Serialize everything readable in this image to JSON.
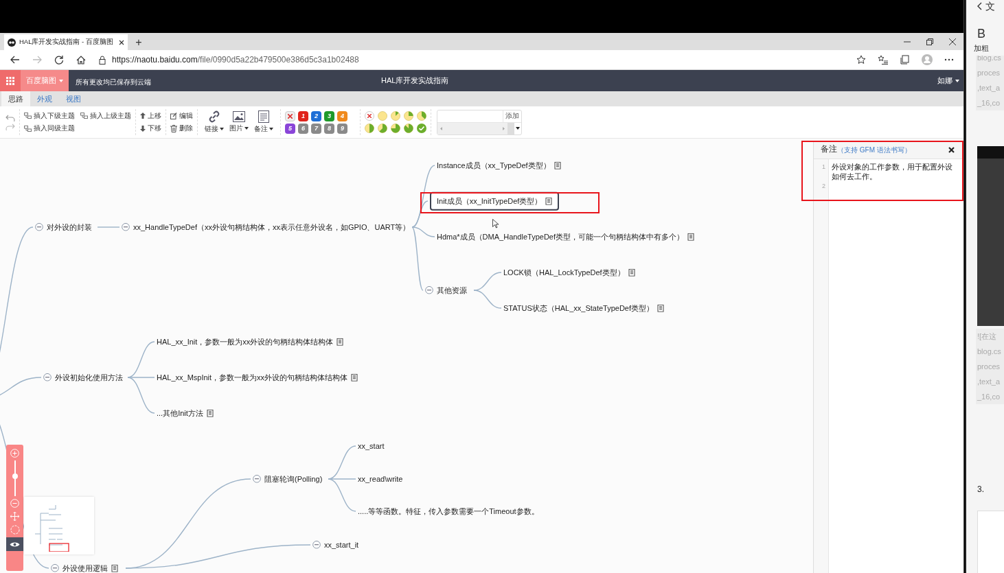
{
  "browser": {
    "tab_title": "HAL库开发实战指南 - 百度脑图",
    "new_tab": "+",
    "url_host": "https://naotu.baidu.com",
    "url_path": "/file/0990d5a22b479500e386d5c3a1b02488"
  },
  "app": {
    "brand": "百度脑图",
    "save_status": "所有更改均已保存到云端",
    "doc_title": "HAL库开发实战指南",
    "user": "如娜"
  },
  "tabs": [
    {
      "label": "思路",
      "selected": true
    },
    {
      "label": "外观",
      "selected": false
    },
    {
      "label": "视图",
      "selected": false
    }
  ],
  "toolbar": {
    "insert_child": "插入下级主题",
    "insert_parent": "插入上级主题",
    "insert_sibling": "插入同级主题",
    "move_up": "上移",
    "move_down": "下移",
    "edit": "编辑",
    "delete": "删除",
    "link": "链接",
    "image": "图片",
    "note": "备注",
    "priorities": [
      {
        "kind": "clear"
      },
      {
        "kind": "number",
        "label": "1",
        "color": "#e0241c"
      },
      {
        "kind": "number",
        "label": "2",
        "color": "#1f6fd6"
      },
      {
        "kind": "number",
        "label": "3",
        "color": "#1f9a2a"
      },
      {
        "kind": "number",
        "label": "4",
        "color": "#f08a1c"
      },
      {
        "kind": "number",
        "label": "5",
        "color": "#8a45d8"
      },
      {
        "kind": "number",
        "label": "6",
        "color": "#8a8a8a"
      },
      {
        "kind": "number",
        "label": "7",
        "color": "#8a8a8a"
      },
      {
        "kind": "number",
        "label": "8",
        "color": "#8a8a8a"
      },
      {
        "kind": "number",
        "label": "9",
        "color": "#8a8a8a"
      }
    ],
    "progress": [
      {
        "kind": "clear"
      },
      {
        "kind": "empty"
      },
      {
        "kind": "eighth"
      },
      {
        "kind": "quarter"
      },
      {
        "kind": "threeeighths"
      },
      {
        "kind": "half"
      },
      {
        "kind": "fiveeighths"
      },
      {
        "kind": "threequarters"
      },
      {
        "kind": "seveneighths"
      },
      {
        "kind": "done"
      }
    ],
    "tag_button": "添加"
  },
  "mindmap": {
    "nodes": [
      {
        "text": "对外设的封装",
        "expanded": true,
        "children": [
          {
            "text": "xx_HandleTypeDef（xx外设句柄结构体，xx表示任意外设名，如GPIO、UART等）",
            "expanded": true,
            "children": [
              {
                "text": "Instance成员（xx_TypeDef类型）",
                "note": true
              },
              {
                "text": "Init成员（xx_InitTypeDef类型）",
                "note": true,
                "selected": true
              },
              {
                "text": "Hdma*成员（DMA_HandleTypeDef类型，可能一个句柄结构体中有多个）",
                "note": true
              },
              {
                "text": "其他资源",
                "expanded": true,
                "children": [
                  {
                    "text": "LOCK锁（HAL_LockTypeDef类型）",
                    "note": true
                  },
                  {
                    "text": "STATUS状态（HAL_xx_StateTypeDef类型）",
                    "note": true
                  }
                ]
              }
            ]
          }
        ]
      },
      {
        "text": "外设初始化使用方法",
        "expanded": true,
        "children": [
          {
            "text": "HAL_xx_Init，参数一般为xx外设的句柄结构体结构体",
            "note": true
          },
          {
            "text": "HAL_xx_MspInit，参数一般为xx外设的句柄结构体结构体",
            "note": true
          },
          {
            "text": "...其他Init方法",
            "note": true
          }
        ]
      },
      {
        "text": "外设使用逻辑",
        "expanded": true,
        "note": true,
        "children": [
          {
            "text": "阻塞轮询(Polling)",
            "expanded": true,
            "children": [
              {
                "text": "xx_start"
              },
              {
                "text": "xx_read\\write"
              },
              {
                "text": ".....等等函数。特征，传入参数需要一个Timeout参数。"
              }
            ]
          },
          {
            "text": "xx_start_it",
            "expanded": true
          }
        ]
      }
    ]
  },
  "note_panel": {
    "title": "备注",
    "hint": "（支持 GFM 语法书写）",
    "lines": [
      {
        "number": "1",
        "text": "外设对象的工作参数，用于配置外设如何去工作。"
      },
      {
        "number": "2"
      }
    ]
  },
  "zoom": {
    "level": 0.56
  },
  "side_window": {
    "header_char": "文",
    "bold_button": "B",
    "bold_label": "加粗",
    "snippet_top": [
      "blog.cs",
      "proces",
      ",text_a",
      "_16,co"
    ],
    "snippet_bottom": [
      "![在这",
      "blog.cs",
      "proces",
      ",text_a",
      "_16,co"
    ],
    "list_marker": "3."
  }
}
